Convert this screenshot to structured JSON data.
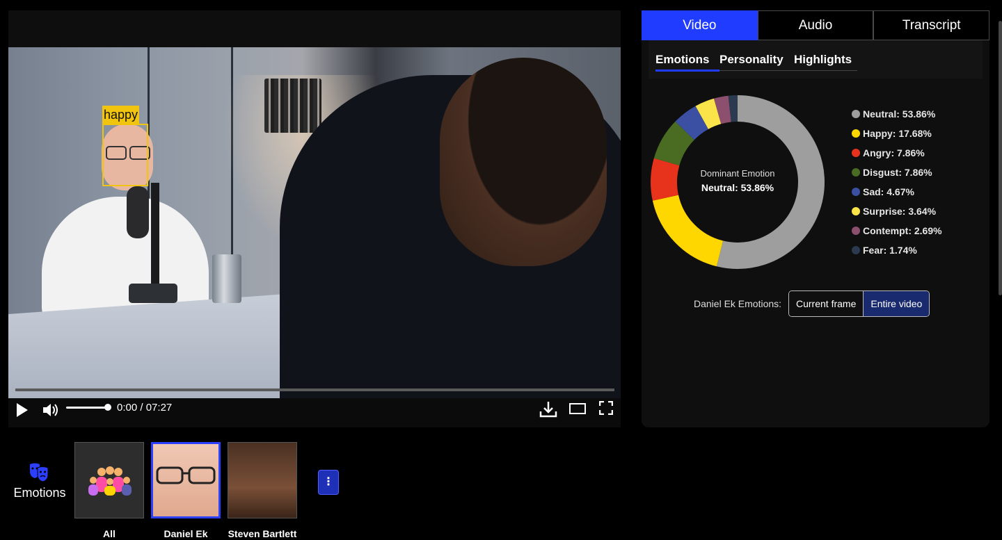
{
  "player": {
    "face_label": "happy",
    "time_current": "0:00",
    "time_separator": " / ",
    "time_total": "07:27",
    "progress_fraction": 0.0,
    "volume_fraction": 1.0,
    "icons": {
      "play": "play-icon",
      "volume": "volume-icon",
      "download": "download-icon",
      "theater": "theater-mode-icon",
      "fullscreen": "fullscreen-icon"
    }
  },
  "tabs": [
    {
      "label": "Video",
      "active": true
    },
    {
      "label": "Audio",
      "active": false
    },
    {
      "label": "Transcript",
      "active": false
    }
  ],
  "subtabs": [
    {
      "label": "Emotions",
      "active": true
    },
    {
      "label": "Personality",
      "active": false
    },
    {
      "label": "Highlights",
      "active": false
    }
  ],
  "dominant": {
    "label": "Dominant Emotion",
    "value": "Neutral: 53.86%"
  },
  "chart_data": {
    "type": "pie",
    "donut": true,
    "categories": [
      "Neutral",
      "Happy",
      "Angry",
      "Disgust",
      "Sad",
      "Surprise",
      "Contempt",
      "Fear"
    ],
    "values": [
      53.86,
      17.68,
      7.86,
      7.86,
      4.67,
      3.64,
      2.69,
      1.74
    ],
    "colors": [
      "#9e9e9e",
      "#ffd700",
      "#e8331c",
      "#4a6b22",
      "#3b4fa3",
      "#fbe34a",
      "#8c4f6e",
      "#2b3a4f"
    ],
    "legend": [
      "Neutral: 53.86%",
      "Happy: 17.68%",
      "Angry: 7.86%",
      "Disgust: 7.86%",
      "Sad: 4.67%",
      "Surprise: 3.64%",
      "Contempt: 2.69%",
      "Fear: 1.74%"
    ],
    "legend_position": "right"
  },
  "scope": {
    "label": "Daniel Ek Emotions:",
    "options": [
      {
        "label": "Current frame",
        "active": false
      },
      {
        "label": "Entire video",
        "active": true
      }
    ]
  },
  "bottom": {
    "emotions_label": "Emotions",
    "thumbnails": [
      {
        "name": "All",
        "selected": false
      },
      {
        "name": "Daniel Ek",
        "selected": true
      },
      {
        "name": "Steven Bartlett",
        "selected": false
      }
    ],
    "more_button": "⋮"
  }
}
